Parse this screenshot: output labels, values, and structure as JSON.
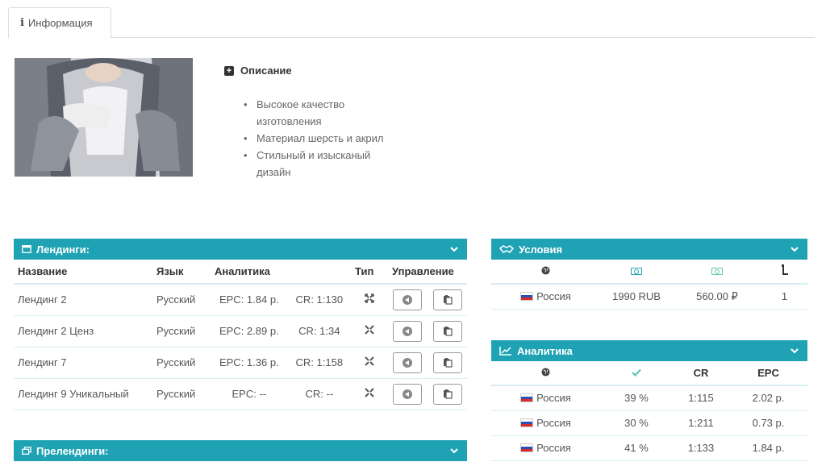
{
  "tab": {
    "label": "Информация"
  },
  "description": {
    "title": "Описание",
    "items": [
      "Высокое качество изготовления",
      "Материал шерсть и акрил",
      "Стильный и изысканый дизайн"
    ]
  },
  "landings": {
    "title": "Лендинги:",
    "columns": {
      "name": "Название",
      "lang": "Язык",
      "analytics": "Аналитика",
      "type": "Тип",
      "manage": "Управление"
    },
    "rows": [
      {
        "name": "Лендинг 2",
        "lang": "Русский",
        "epc": "EPC: 1.84 р.",
        "cr": "CR: 1:130"
      },
      {
        "name": "Лендинг 2 Ценз",
        "lang": "Русский",
        "epc": "EPC: 2.89 р.",
        "cr": "CR: 1:34"
      },
      {
        "name": "Лендинг 7",
        "lang": "Русский",
        "epc": "EPC: 1.36 р.",
        "cr": "CR: 1:158"
      },
      {
        "name": "Лендинг 9 Уникальный",
        "lang": "Русский",
        "epc": "EPC: --",
        "cr": "CR: --"
      }
    ]
  },
  "prelandings": {
    "title": "Прелендинги:"
  },
  "conditions": {
    "title": "Условия",
    "rows": [
      {
        "country": "Россия",
        "price": "1990 RUB",
        "payout": "560.00 ₽",
        "limit": "1"
      }
    ]
  },
  "analytics": {
    "title": "Аналитика",
    "columns": {
      "cr": "CR",
      "epc": "EPC"
    },
    "rows": [
      {
        "country": "Россия",
        "approve": "39 %",
        "cr": "1:115",
        "epc": "2.02 р."
      },
      {
        "country": "Россия",
        "approve": "30 %",
        "cr": "1:211",
        "epc": "0.73 р."
      },
      {
        "country": "Россия",
        "approve": "41 %",
        "cr": "1:133",
        "epc": "1.84 р."
      }
    ]
  },
  "colors": {
    "accent": "#1fa3b4",
    "check": "#5fc9b4"
  }
}
